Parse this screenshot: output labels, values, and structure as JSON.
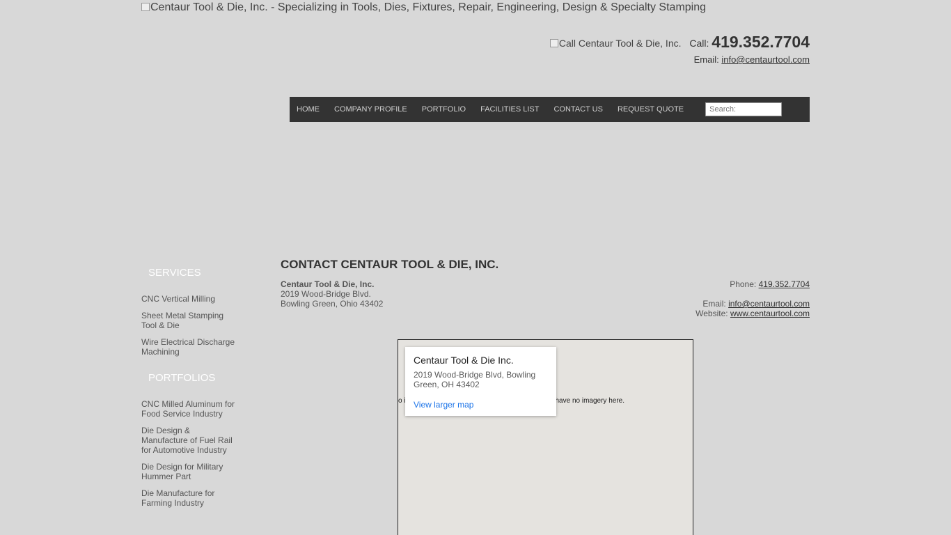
{
  "header": {
    "logo_alt": "Centaur Tool & Die, Inc. - Specializing in Tools, Dies, Fixtures, Repair, Engineering, Design & Specialty Stamping",
    "call_image_alt": "Call Centaur Tool & Die, Inc.",
    "call_label": "Call:",
    "phone": "419.352.7704",
    "email_label": "Email:",
    "email": "info@centaurtool.com"
  },
  "nav": {
    "items": [
      "HOME",
      "COMPANY PROFILE",
      "PORTFOLIO",
      "FACILITIES LIST",
      "CONTACT US",
      "REQUEST QUOTE"
    ],
    "search_placeholder": "Search:"
  },
  "sidebar": {
    "services_heading": "SERVICES",
    "services": [
      "CNC Vertical Milling",
      "Sheet Metal Stamping Tool & Die",
      "Wire Electrical Discharge Machining"
    ],
    "portfolios_heading": "PORTFOLIOS",
    "portfolios": [
      "CNC Milled Aluminum for Food Service Industry",
      "Die Design & Manufacture of Fuel Rail for Automotive Industry",
      "Die Design for Military Hummer Part",
      "Die Manufacture for Farming Industry"
    ]
  },
  "main": {
    "title": "CONTACT CENTAUR TOOL & DIE, INC.",
    "company": "Centaur Tool & Die, Inc.",
    "street": "2019 Wood-Bridge Blvd.",
    "city": "Bowling Green, Ohio 43402",
    "phone_label": "Phone:",
    "phone": "419.352.7704",
    "email_label": "Email:",
    "email": "info@centaurtool.com",
    "website_label": "Website:",
    "website": "www.centaurtool.com"
  },
  "map": {
    "no_imagery_left": "o i",
    "no_imagery_right": "have no imagery here.",
    "card_title": "Centaur Tool & Die Inc.",
    "card_address": "2019 Wood-Bridge Blvd, Bowling Green, OH 43402",
    "card_link": "View larger map"
  }
}
